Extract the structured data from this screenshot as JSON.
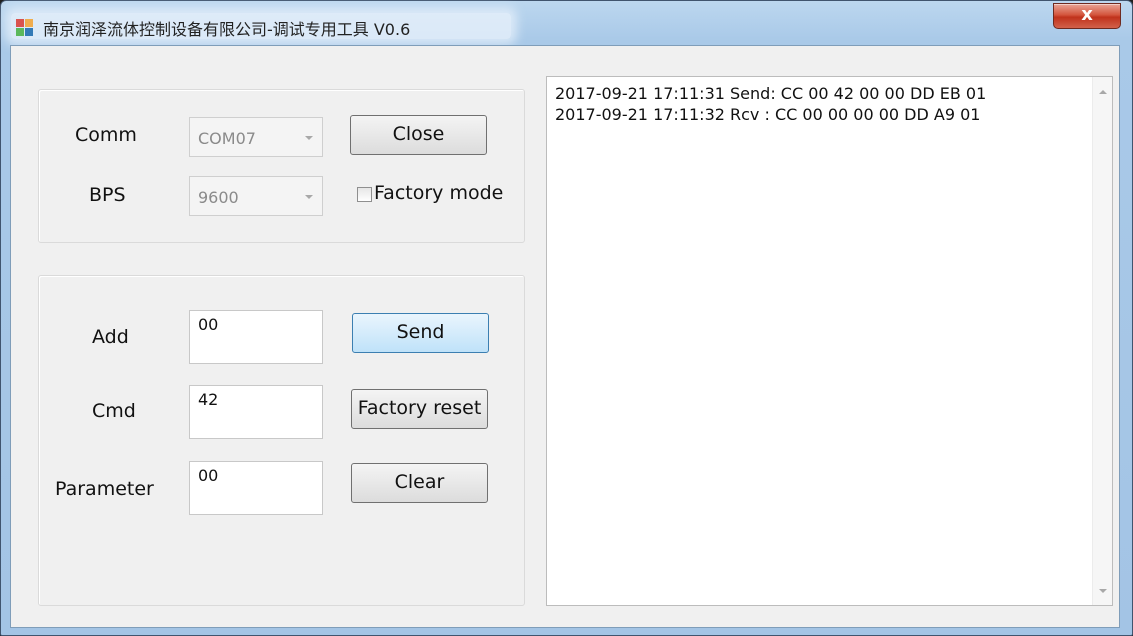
{
  "window": {
    "title": "南京润泽流体控制设备有限公司-调试专用工具 V0.6",
    "close_glyph": "x"
  },
  "serial": {
    "comm_label": "Comm",
    "comm_value": "COM07",
    "bps_label": "BPS",
    "bps_value": "9600",
    "close_label": "Close",
    "factory_mode_label": "Factory mode",
    "factory_mode_checked": false
  },
  "command": {
    "add_label": "Add",
    "add_value": "00",
    "cmd_label": "Cmd",
    "cmd_value": "42",
    "parameter_label": "Parameter",
    "parameter_value": "00",
    "send_label": "Send",
    "factory_reset_label": "Factory reset",
    "clear_label": "Clear"
  },
  "log": {
    "lines": [
      "2017-09-21 17:11:31 Send: CC 00 42 00 00 DD EB 01",
      "2017-09-21 17:11:32  Rcv : CC 00 00 00 00 DD A9 01"
    ]
  },
  "icons": {
    "app": "app-icon",
    "scroll_up": "scroll-up-arrow-icon",
    "scroll_down": "scroll-down-arrow-icon",
    "combo_arrow": "chevron-down-icon"
  },
  "colors": {
    "title_bar": "#a9c9e8",
    "close_button": "#c0321c",
    "default_button": "#bfe2f9"
  }
}
